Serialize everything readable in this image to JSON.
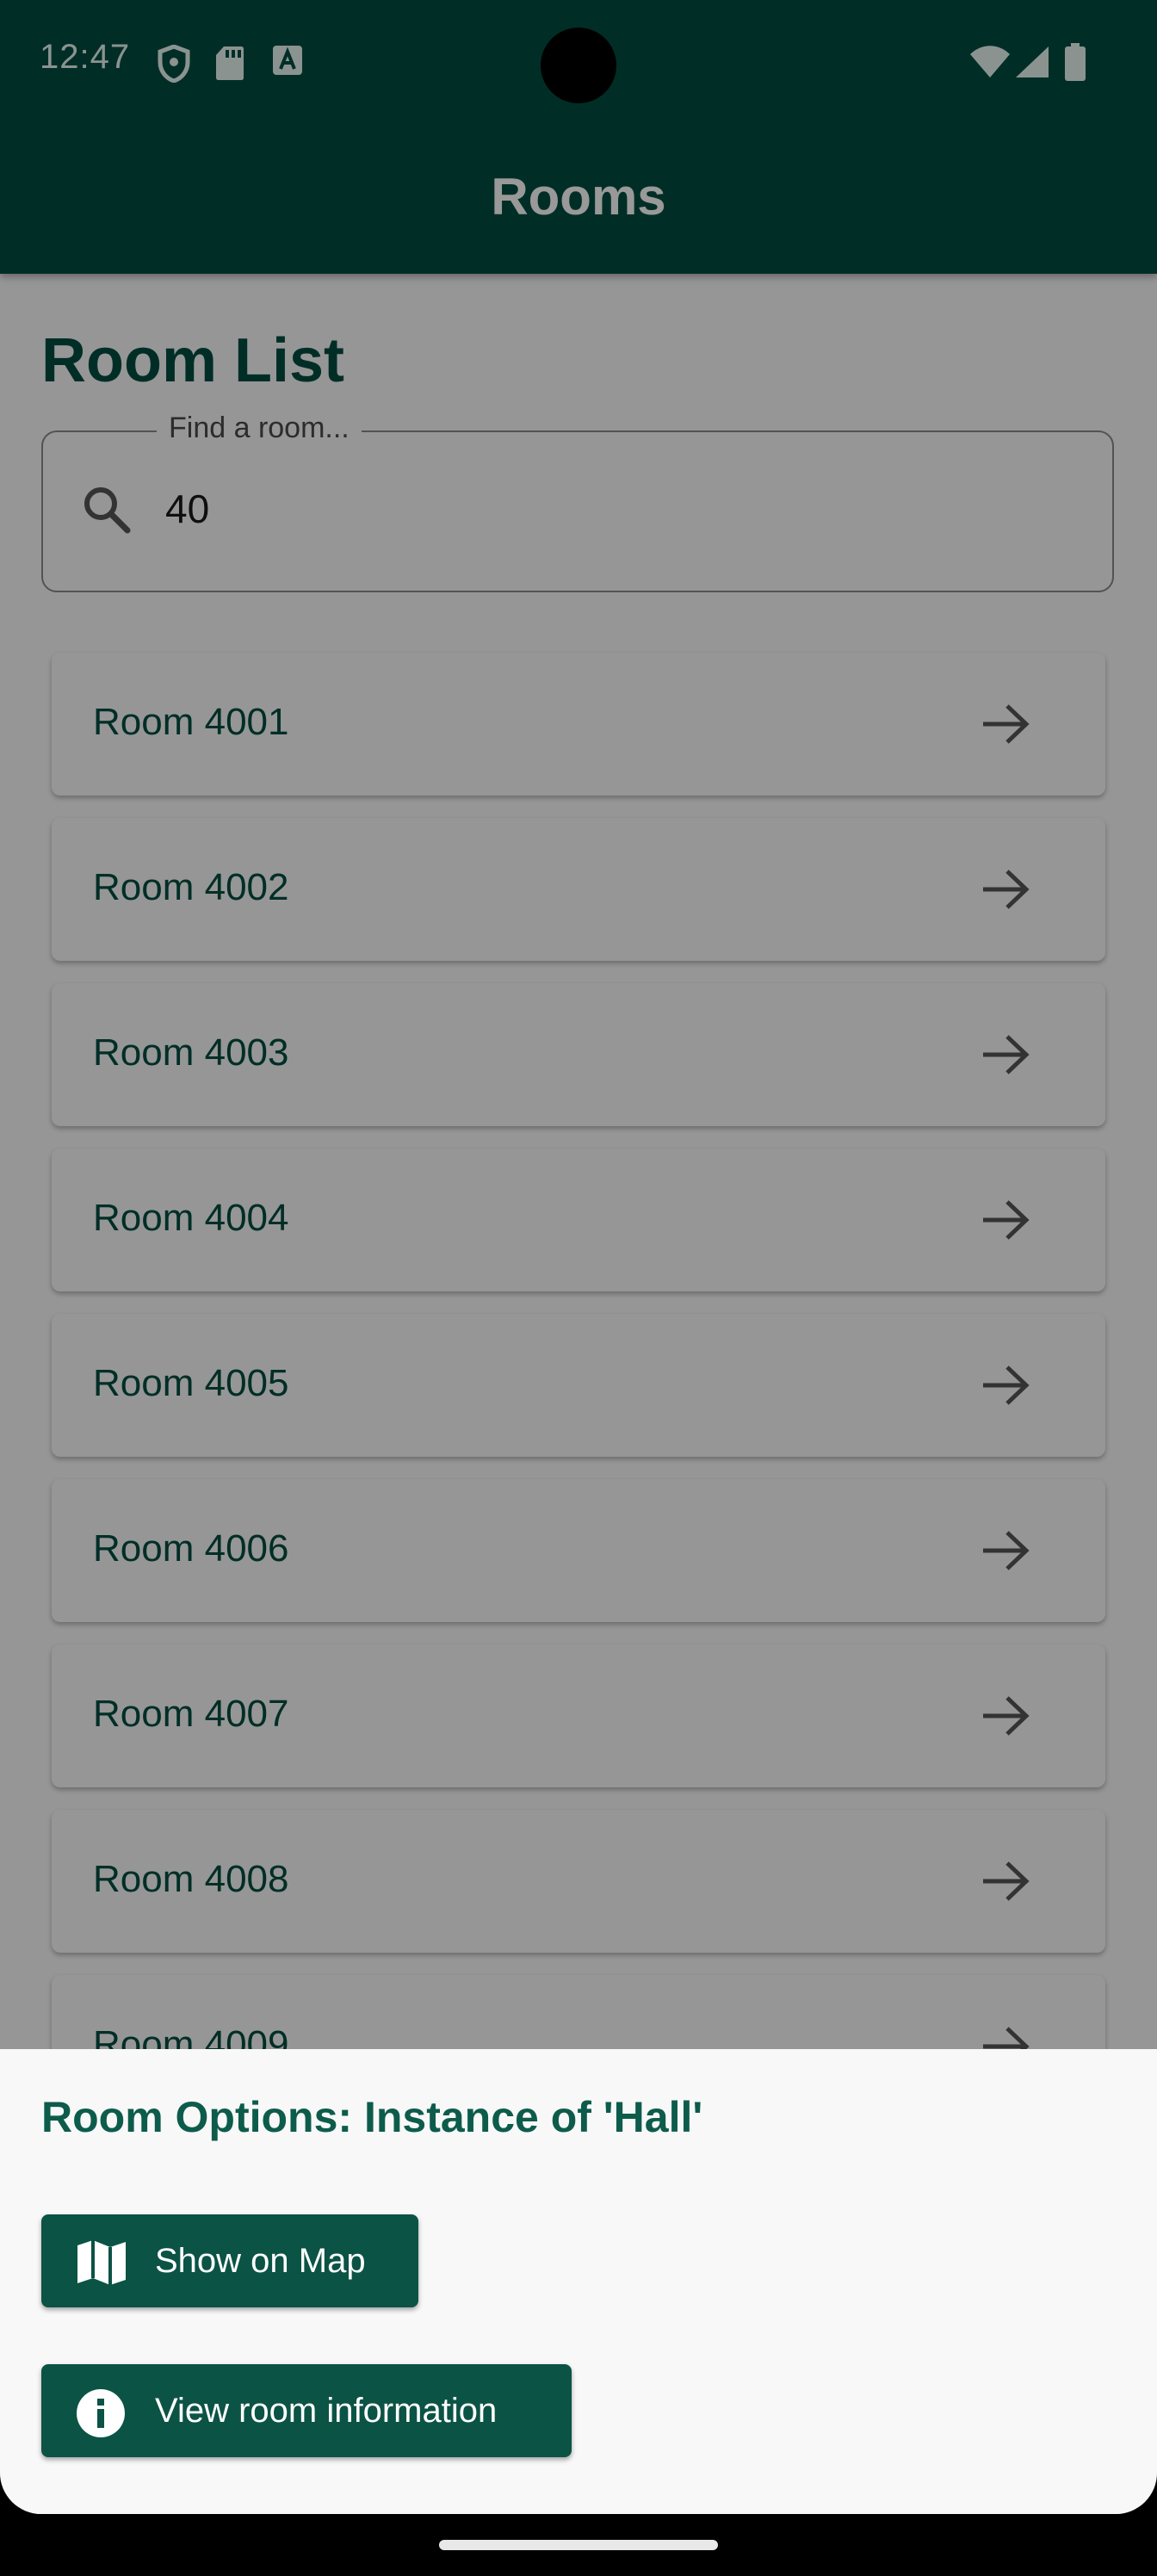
{
  "status_bar": {
    "time": "12:47",
    "icons": [
      "shield-icon",
      "sd-card-icon",
      "font-a-icon",
      "wifi-icon",
      "cell-signal-icon",
      "battery-icon"
    ]
  },
  "app_bar": {
    "title": "Rooms"
  },
  "page": {
    "title": "Room List"
  },
  "search": {
    "label": "Find a room...",
    "value": "40",
    "icon": "search-icon"
  },
  "rooms": [
    {
      "label": "Room 4001"
    },
    {
      "label": "Room 4002"
    },
    {
      "label": "Room 4003"
    },
    {
      "label": "Room 4004"
    },
    {
      "label": "Room 4005"
    },
    {
      "label": "Room 4006"
    },
    {
      "label": "Room 4007"
    },
    {
      "label": "Room 4008"
    },
    {
      "label": "Room 4009"
    }
  ],
  "bottom_sheet": {
    "title": "Room Options: Instance of 'Hall'",
    "actions": [
      {
        "label": "Show on Map",
        "icon": "map-icon"
      },
      {
        "label": "View room information",
        "icon": "info-icon"
      }
    ]
  },
  "colors": {
    "primary": "#004d40",
    "button": "#0b5345",
    "sheet_background": "#f8f8f8"
  }
}
